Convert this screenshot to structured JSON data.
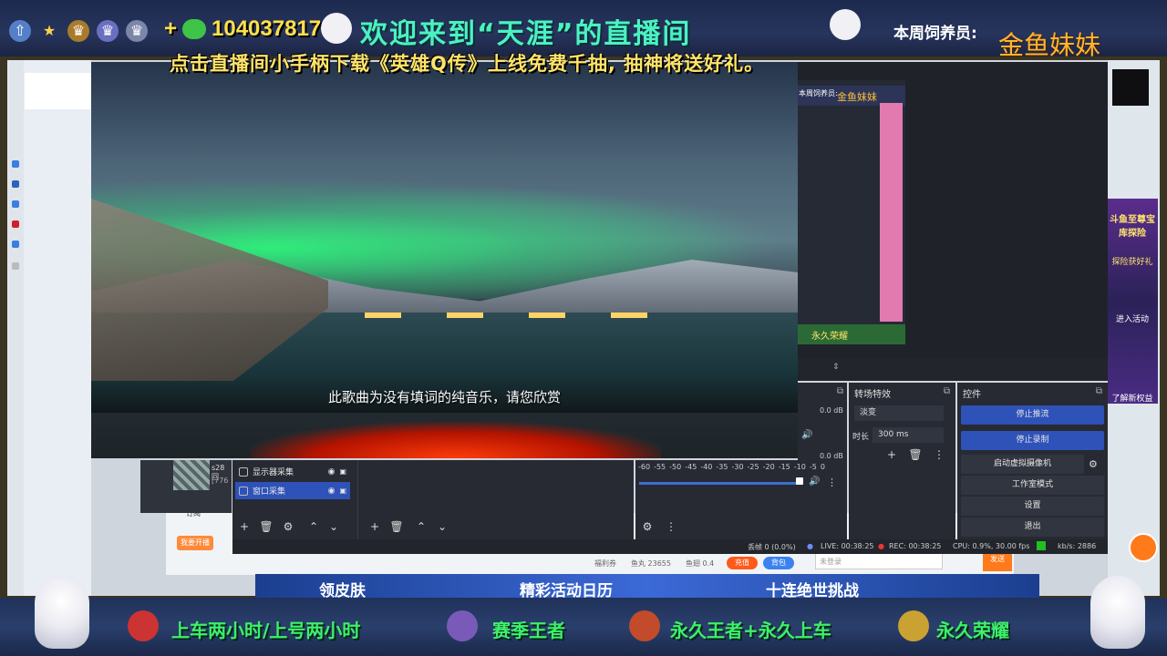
{
  "banner_top": {
    "phone": "1040378173",
    "plus_sign": "+",
    "welcome": "欢迎来到“天涯”的直播间",
    "feeder_label": "本周饲养员:",
    "feeder_name": "金鱼妹妹",
    "notice": "点击直播间小手柄下载《英雄Q传》上线免费千抽, 抽神将送好礼。"
  },
  "video": {
    "subtitle": "此歌曲为没有填词的纯音乐，请您欣赏"
  },
  "nested_preview": {
    "feeder_label": "本周饲养员:",
    "feeder_name": "金鱼妹妹",
    "footer": "永久荣耀"
  },
  "right_sidebar": {
    "banner_title": "斗鱼至尊宝库探险",
    "banner_sub": "探险获好礼",
    "btn_enter": "进入活动",
    "btn_rights": "了解新权益"
  },
  "sources": {
    "items": [
      {
        "label": "显示器采集",
        "selected": false
      },
      {
        "label": "窗口采集",
        "selected": true
      }
    ]
  },
  "mini_window": {
    "line1": "s28回",
    "line2": "[776"
  },
  "audio": {
    "db_top": "0.0 dB",
    "db_bottom": "0.0 dB",
    "scale": [
      "-60",
      "-55",
      "-50",
      "-45",
      "-40",
      "-35",
      "-30",
      "-25",
      "-20",
      "-15",
      "-10",
      "-5",
      "0"
    ]
  },
  "transitions": {
    "title": "转场特效",
    "selected": "淡变",
    "duration_label": "时长",
    "duration_value": "300 ms"
  },
  "controls": {
    "title": "控件",
    "buttons": [
      "停止推流",
      "停止录制",
      "启动虚拟摄像机",
      "工作室模式",
      "设置",
      "退出"
    ]
  },
  "status_bar": {
    "dropped": "丢帧 0 (0.0%)",
    "live": "LIVE: 00:38:25",
    "rec": "REC: 00:38:25",
    "cpu": "CPU: 0.9%, 30.00 fps",
    "kbps": "kb/s: 2886"
  },
  "browser_bottom": {
    "wifi_label": "福利券",
    "gold_label": "鱼丸 23655",
    "fish_label": "鱼翅 0.4",
    "recharge": "充值",
    "bag": "背包",
    "chat_placeholder": "未登录",
    "send": "发送",
    "signup_btn": "我要开播",
    "subscribe": "订阅"
  },
  "ad_strip": [
    "领皮肤",
    "精彩活动日历",
    "十连绝世挑战"
  ],
  "bottom_banner": {
    "promos": [
      "上车两小时/上号两小时",
      "赛季王者",
      "永久王者+永久上车",
      "永久荣耀"
    ]
  },
  "colors": {
    "accent_blue": "#2e52b8",
    "banner_green": "#3df06a",
    "welcome_teal": "#4bf2c1",
    "feeder_orange": "#ffb52e"
  }
}
